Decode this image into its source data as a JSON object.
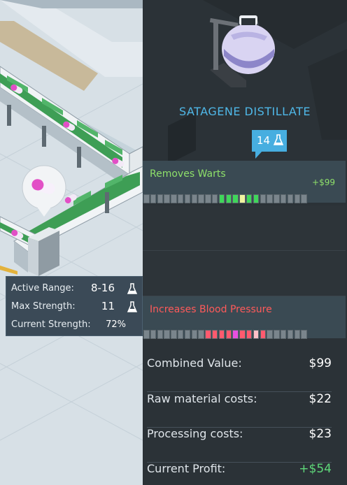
{
  "product": {
    "name": "SATAGENE DISTILLATE",
    "strength": "14"
  },
  "effects": [
    {
      "name": "Removes Warts",
      "price": "+$99",
      "name_color": "#8ee06a",
      "price_color": "#8ee06a",
      "cells": [
        "g",
        "g",
        "g",
        "g",
        "g",
        "g",
        "g",
        "g",
        "g",
        "g",
        "g",
        "G",
        "G",
        "G",
        "Y",
        "G",
        "G",
        "g",
        "g",
        "g",
        "g",
        "g",
        "g",
        "g"
      ]
    },
    {
      "name": "Increases Blood Pressure",
      "price": "",
      "name_color": "#ff5a5a",
      "price_color": "#ff5a5a",
      "cells": [
        "g",
        "g",
        "g",
        "g",
        "g",
        "g",
        "g",
        "g",
        "g",
        "R",
        "R",
        "R",
        "R",
        "M",
        "R",
        "R",
        "P",
        "R",
        "g",
        "g",
        "g",
        "g",
        "g",
        "g"
      ]
    }
  ],
  "stats": {
    "active_range_label": "Active Range:",
    "active_range_value": "8-16",
    "max_strength_label": "Max Strength:",
    "max_strength_value": "11",
    "current_strength_label": "Current Strength:",
    "current_strength_value": "72%"
  },
  "summary": {
    "combined_label": "Combined Value:",
    "combined_value": "$99",
    "raw_label": "Raw material costs:",
    "raw_value": "$22",
    "processing_label": "Processing costs:",
    "processing_value": "$23",
    "profit_label": "Current Profit:",
    "profit_value": "+$54",
    "profit_color": "#5fd87a"
  },
  "colors": {
    "accent": "#47aee0",
    "panel": "#2d3338",
    "cell_grey": "#7a858c",
    "cell_green": "#3fd65a",
    "cell_yellow": "#f0f3a0",
    "cell_red": "#ff5a6e",
    "cell_magenta": "#e850e0",
    "cell_pink": "#ffc0c8"
  },
  "icons": {
    "flask": "flask-icon",
    "pill": "pill-icon",
    "distiller": "distiller-icon"
  }
}
